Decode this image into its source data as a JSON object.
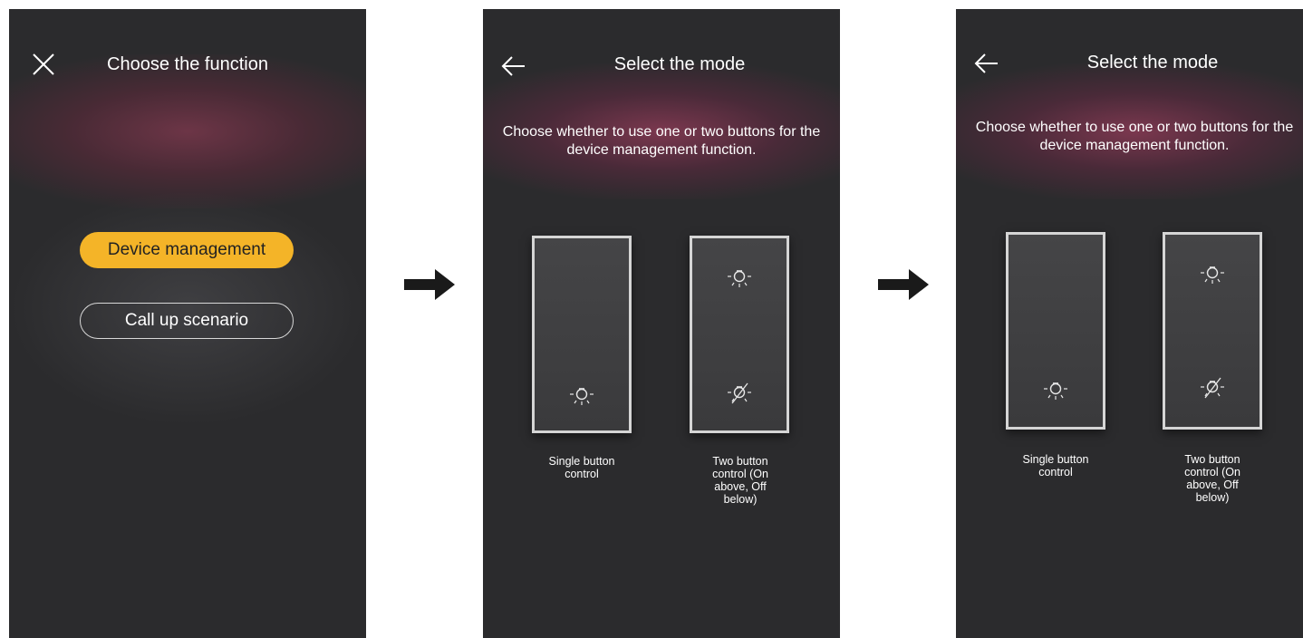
{
  "screen1": {
    "title": "Choose the function",
    "close_icon": "close-icon",
    "options": [
      {
        "label": "Device management",
        "selected": true
      },
      {
        "label": "Call up scenario",
        "selected": false
      }
    ],
    "accent_color": "#f4b428"
  },
  "screen2": {
    "title": "Select the mode",
    "back_icon": "arrow-left-icon",
    "description": "Choose whether to use one or two buttons for the device management function.",
    "single_caption": "Single button control",
    "two_caption": "Two button control (On above, Off below)"
  },
  "screen3": {
    "title": "Select the mode",
    "back_icon": "arrow-left-icon",
    "description": "Choose whether to use one or two buttons for the device management function.",
    "single_caption": "Single button control",
    "two_caption": "Two button control (On above, Off below)"
  },
  "flow_arrow_icon": "arrow-right-icon",
  "colors": {
    "screen_bg": "#2b2b2d",
    "glow": "#8c3c5a"
  }
}
